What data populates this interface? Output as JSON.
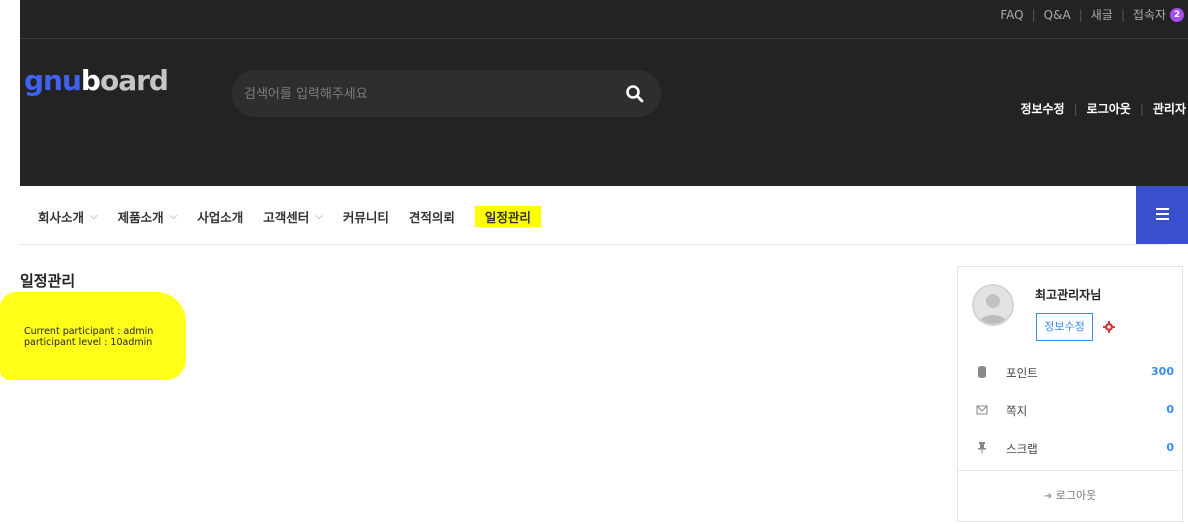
{
  "top_links": {
    "faq": "FAQ",
    "qa": "Q&A",
    "new": "새글",
    "visitors": "접속자",
    "visitor_count": "2"
  },
  "logo": {
    "part1": "gnu",
    "part2": "b",
    "part3": "oard"
  },
  "search": {
    "placeholder": "검색어를 입력해주세요"
  },
  "user_links": {
    "edit": "정보수정",
    "logout": "로그아웃",
    "admin": "관리자"
  },
  "nav": {
    "items": [
      {
        "label": "회사소개",
        "chevron": "⌵"
      },
      {
        "label": "제품소개",
        "chevron": "⌵"
      },
      {
        "label": "사업소개",
        "chevron": ""
      },
      {
        "label": "고객센터",
        "chevron": "⌵"
      },
      {
        "label": "커뮤니티",
        "chevron": ""
      },
      {
        "label": "견적의뢰",
        "chevron": ""
      },
      {
        "label": "일정관리",
        "chevron": ""
      }
    ]
  },
  "page": {
    "title": "일정관리",
    "participant_line": "Current participant : admin",
    "level_line": "participant level : 10admin"
  },
  "profile": {
    "name": "최고관리자님",
    "edit_button": "정보수정",
    "rows": [
      {
        "icon": "database-icon",
        "label": "포인트",
        "value": "300"
      },
      {
        "icon": "envelope-icon",
        "label": "쪽지",
        "value": "0"
      },
      {
        "icon": "pin-icon",
        "label": "스크랩",
        "value": "0"
      }
    ],
    "logout": "로그아웃"
  },
  "colors": {
    "accent": "#3a4fce",
    "link_blue": "#3a8afd",
    "highlight": "#ffff00",
    "header_bg": "#232323"
  }
}
